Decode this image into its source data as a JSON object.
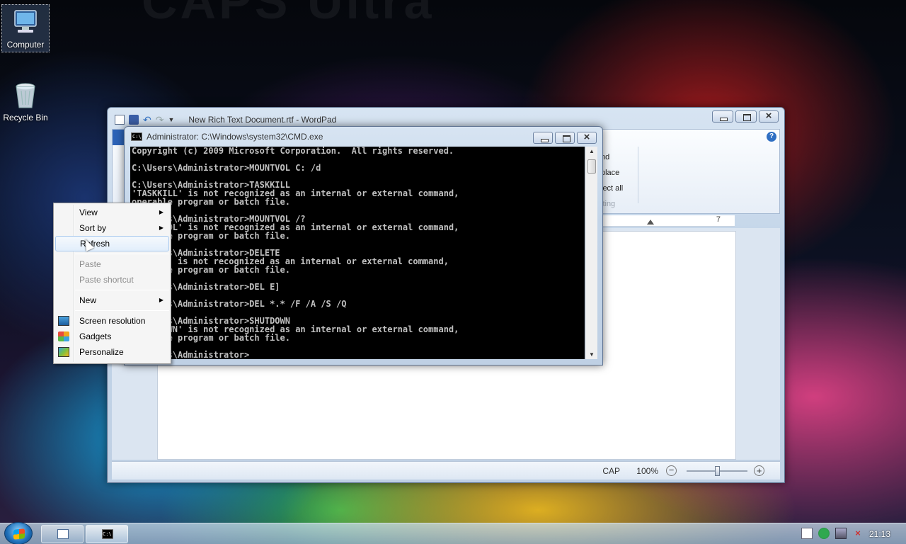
{
  "desktop": {
    "wallpaper_text": "CAPS Ultra",
    "icons": [
      {
        "label": "Computer"
      },
      {
        "label": "Recycle Bin"
      }
    ]
  },
  "wordpad": {
    "title": "New Rich Text Document.rtf - WordPad",
    "editing_group": [
      "nd",
      "place",
      "lect all",
      "iting"
    ],
    "ruler_number": "7",
    "status": {
      "cap": "CAP",
      "zoom": "100%",
      "zoom_out": "−",
      "zoom_in": "+",
      "zoom_level": 1.0
    },
    "help_label": "?"
  },
  "cmd": {
    "title": "Administrator: C:\\Windows\\system32\\CMD.exe",
    "icon_label": "C:\\",
    "lines": [
      "Copyright (c) 2009 Microsoft Corporation.  All rights reserved.",
      "",
      "C:\\Users\\Administrator>MOUNTVOL C: /d",
      "",
      "C:\\Users\\Administrator>TASKKILL",
      "'TASKKILL' is not recognized as an internal or external command,",
      "operable program or batch file.",
      "",
      "       s\\Administrator>MOUNTVOL /?",
      "       OL' is not recognized as an internal or external command,",
      "       e program or batch file.",
      "",
      "       s\\Administrator>DELETE",
      "       ' is not recognized as an internal or external command,",
      "       e program or batch file.",
      "",
      "       s\\Administrator>DEL E]",
      "",
      "       s\\Administrator>DEL *.* /F /A /S /Q",
      "",
      "       s\\Administrator>SHUTDOWN",
      "       WN' is not recognized as an internal or external command,",
      "       e program or batch file.",
      "",
      "       s\\Administrator>"
    ]
  },
  "context_menu": {
    "items": [
      {
        "label": "View",
        "submenu": true
      },
      {
        "label": "Sort by",
        "submenu": true
      },
      {
        "label": "Refresh"
      },
      {
        "label": "Paste"
      },
      {
        "label": "Paste shortcut"
      },
      {
        "label": "New",
        "submenu": true
      },
      {
        "label": "Screen resolution",
        "icon": "screen-resolution-icon"
      },
      {
        "label": "Gadgets",
        "icon": "gadgets-icon"
      },
      {
        "label": "Personalize",
        "icon": "personalize-icon"
      }
    ]
  },
  "taskbar": {
    "clock": "21:13",
    "cmd_icon_label": "C:\\"
  }
}
